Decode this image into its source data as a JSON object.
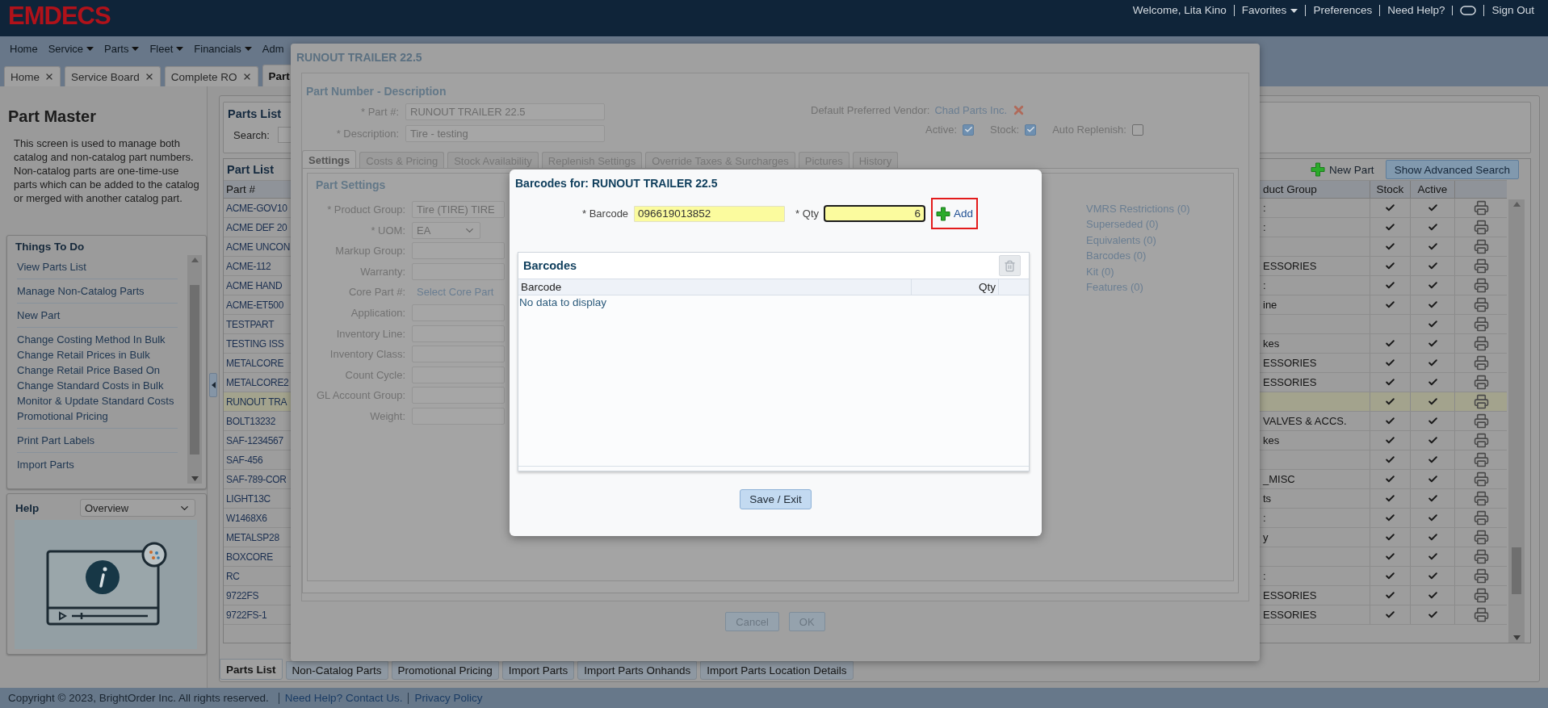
{
  "header": {
    "logo": "EMDECS",
    "links": [
      {
        "kind": "text",
        "label": "Welcome, Lita Kino"
      },
      {
        "kind": "menu",
        "label": "Favorites"
      },
      {
        "kind": "link",
        "label": "Preferences"
      },
      {
        "kind": "link",
        "label": "Need Help?"
      },
      {
        "kind": "toggle"
      },
      {
        "kind": "link",
        "label": "Sign Out"
      }
    ]
  },
  "nav": [
    {
      "label": "Home",
      "menu": false
    },
    {
      "label": "Service",
      "menu": true
    },
    {
      "label": "Parts",
      "menu": true
    },
    {
      "label": "Fleet",
      "menu": true
    },
    {
      "label": "Financials",
      "menu": true
    },
    {
      "label": "Adm",
      "menu": false
    }
  ],
  "page_tabs": [
    {
      "label": "Home",
      "closable": true,
      "selected": false
    },
    {
      "label": "Service Board",
      "closable": true,
      "selected": false
    },
    {
      "label": "Complete RO",
      "closable": true,
      "selected": false
    },
    {
      "label": "Part",
      "closable": false,
      "selected": true
    }
  ],
  "left_panel": {
    "title": "Part Master",
    "description": "This screen is used to manage both catalog and non-catalog part numbers. Non-catalog parts are one-time-use parts which can be added to the catalog or merged with another catalog part.",
    "things_to_do": {
      "title": "Things To Do",
      "groups": [
        [
          "View Parts List"
        ],
        [
          "Manage Non-Catalog Parts"
        ],
        [
          "New Part"
        ],
        [
          "Change Costing Method In Bulk",
          "Change Retail Prices in Bulk",
          "Change Retail Price Based On",
          "Change Standard Costs in Bulk",
          "Monitor & Update Standard Costs",
          "Promotional Pricing"
        ],
        [
          "Print Part Labels"
        ],
        [
          "Import Parts"
        ]
      ]
    },
    "help": {
      "title": "Help",
      "topic": "Overview"
    }
  },
  "parts_list": {
    "title": "Parts List",
    "search_label": "Search:",
    "list_title": "Part List",
    "new_part": "New Part",
    "advanced_search": "Show Advanced Search",
    "columns": [
      "Part #",
      "duct Group",
      "Stock",
      "Active"
    ],
    "rows": [
      {
        "part": "ACME-GOV10",
        "group": ":",
        "stock": true,
        "active": true,
        "selected": false
      },
      {
        "part": "ACME DEF 20",
        "group": ":",
        "stock": true,
        "active": true,
        "selected": false
      },
      {
        "part": "ACME UNCON",
        "group": "",
        "stock": true,
        "active": true,
        "selected": false
      },
      {
        "part": "ACME-112",
        "group": "ESSORIES",
        "stock": true,
        "active": true,
        "selected": false
      },
      {
        "part": "ACME HAND",
        "group": ":",
        "stock": true,
        "active": true,
        "selected": false
      },
      {
        "part": "ACME-ET500",
        "group": "ine",
        "stock": true,
        "active": true,
        "selected": false
      },
      {
        "part": "TESTPART",
        "group": "",
        "stock": false,
        "active": true,
        "selected": false
      },
      {
        "part": "TESTING ISS",
        "group": "kes",
        "stock": true,
        "active": true,
        "selected": false
      },
      {
        "part": "METALCORE",
        "group": "ESSORIES",
        "stock": true,
        "active": true,
        "selected": false
      },
      {
        "part": "METALCORE2",
        "group": "ESSORIES",
        "stock": true,
        "active": true,
        "selected": false
      },
      {
        "part": "RUNOUT TRA",
        "group": "",
        "stock": true,
        "active": true,
        "selected": true
      },
      {
        "part": "BOLT13232",
        "group": "VALVES & ACCS.",
        "stock": true,
        "active": true,
        "selected": false
      },
      {
        "part": "SAF-1234567",
        "group": "kes",
        "stock": true,
        "active": true,
        "selected": false
      },
      {
        "part": "SAF-456",
        "group": "",
        "stock": true,
        "active": true,
        "selected": false
      },
      {
        "part": "SAF-789-COR",
        "group": "_MISC",
        "stock": true,
        "active": true,
        "selected": false
      },
      {
        "part": "LIGHT13C",
        "group": "ts",
        "stock": true,
        "active": true,
        "selected": false
      },
      {
        "part": "W1468X6",
        "group": ":",
        "stock": true,
        "active": true,
        "selected": false
      },
      {
        "part": "METALSP28",
        "group": "y",
        "stock": true,
        "active": true,
        "selected": false
      },
      {
        "part": "BOXCORE",
        "group": "",
        "stock": true,
        "active": true,
        "selected": false
      },
      {
        "part": "RC",
        "group": ":",
        "stock": true,
        "active": true,
        "selected": false
      },
      {
        "part": "9722FS",
        "group": "ESSORIES",
        "stock": true,
        "active": true,
        "selected": false
      },
      {
        "part": "9722FS-1",
        "group": "ESSORIES",
        "stock": true,
        "active": true,
        "selected": false
      }
    ],
    "tabs": [
      {
        "label": "Parts List",
        "selected": true
      },
      {
        "label": "Non-Catalog Parts",
        "selected": false
      },
      {
        "label": "Promotional Pricing",
        "selected": false
      },
      {
        "label": "Import Parts",
        "selected": false
      },
      {
        "label": "Import Parts Onhands",
        "selected": false
      },
      {
        "label": "Import Parts Location Details",
        "selected": false
      }
    ]
  },
  "part_dialog": {
    "title": "RUNOUT TRAILER 22.5",
    "section_title": "Part Number - Description",
    "fields": [
      {
        "label": "* Part #:",
        "value": "RUNOUT TRAILER 22.5"
      },
      {
        "label": "* Description:",
        "value": "Tire - testing"
      }
    ],
    "vendor_label": "Default Preferred Vendor:",
    "vendor": "Chad Parts Inc.",
    "flags": [
      {
        "label": "Active:",
        "checked": true
      },
      {
        "label": "Stock:",
        "checked": true
      },
      {
        "label": "Auto Replenish:",
        "checked": false
      }
    ],
    "tabs": [
      {
        "label": "Settings",
        "selected": true
      },
      {
        "label": "Costs & Pricing",
        "selected": false
      },
      {
        "label": "Stock Availability",
        "selected": false
      },
      {
        "label": "Replenish Settings",
        "selected": false
      },
      {
        "label": "Override Taxes & Surcharges",
        "selected": false
      },
      {
        "label": "Pictures",
        "selected": false
      },
      {
        "label": "History",
        "selected": false
      }
    ],
    "settings_title": "Part Settings",
    "settings": [
      {
        "label": "* Product Group:",
        "kind": "input",
        "value": "Tire (TIRE) TIRE"
      },
      {
        "label": "* UOM:",
        "kind": "select",
        "value": "EA"
      },
      {
        "label": "Markup Group:",
        "kind": "input"
      },
      {
        "label": "Warranty:",
        "kind": "input"
      },
      {
        "label": "Core Part #:",
        "kind": "link",
        "value": "Select Core Part"
      },
      {
        "label": "Application:",
        "kind": "input"
      },
      {
        "label": "Inventory Line:",
        "kind": "input"
      },
      {
        "label": "Inventory Class:",
        "kind": "input"
      },
      {
        "label": "Count Cycle:",
        "kind": "input"
      },
      {
        "label": "GL Account Group:",
        "kind": "input"
      },
      {
        "label": "Weight:",
        "kind": "input"
      }
    ],
    "links": [
      "VMRS Restrictions (0)",
      "Superseded (0)",
      "Equivalents (0)",
      "Barcodes (0)",
      "Kit (0)",
      "Features (0)"
    ],
    "buttons": [
      "Cancel",
      "OK"
    ]
  },
  "barcode_dialog": {
    "title": "Barcodes for: RUNOUT TRAILER 22.5",
    "barcode_label": "* Barcode",
    "barcode": "096619013852",
    "qty_label": "* Qty",
    "qty": "6",
    "add": "Add",
    "grid_title": "Barcodes",
    "columns": [
      "Barcode",
      "Qty"
    ],
    "empty": "No data to display",
    "save": "Save / Exit"
  },
  "footer": {
    "copyright": "Copyright © 2023, BrightOrder Inc. All rights reserved.",
    "links": [
      "Need Help? Contact Us.",
      "Privacy Policy"
    ]
  }
}
